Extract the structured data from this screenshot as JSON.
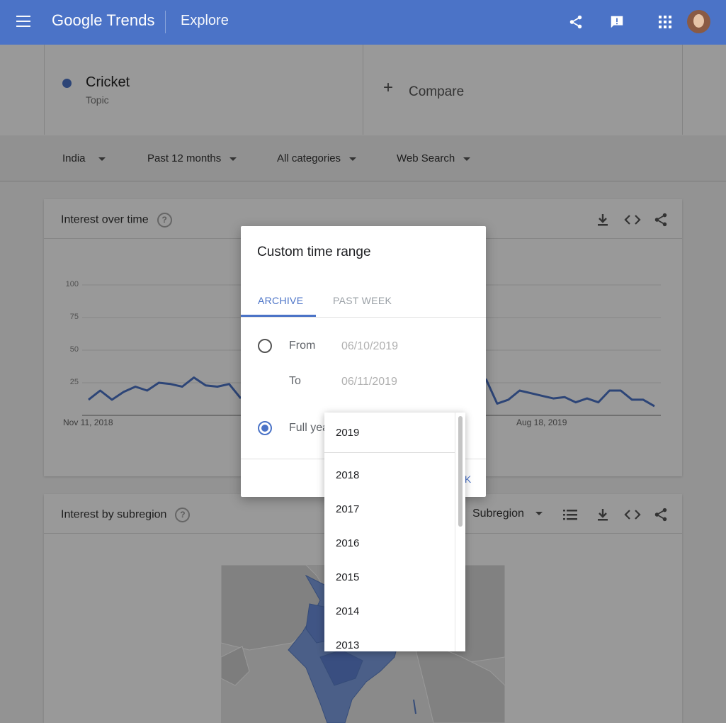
{
  "header": {
    "logo_google": "Google",
    "logo_trends": "Trends",
    "section": "Explore"
  },
  "term": {
    "name": "Cricket",
    "type": "Topic",
    "dot_color": "#4b73c7"
  },
  "compare_label": "Compare",
  "filters": {
    "region": "India",
    "time": "Past 12 months",
    "category": "All categories",
    "property": "Web Search"
  },
  "interest_over_time": {
    "title": "Interest over time",
    "help": "?"
  },
  "chart_data": {
    "type": "line",
    "title": "Interest over time",
    "ylim": [
      0,
      100
    ],
    "y_ticks": [
      "100",
      "75",
      "50",
      "25"
    ],
    "x_tick_labels": [
      "Nov 11, 2018",
      "Aug 18, 2019"
    ],
    "grid": true,
    "series": [
      {
        "color": "#4b73c7",
        "values_left": [
          12,
          19,
          12,
          18,
          22,
          19,
          25,
          24,
          22,
          29,
          23,
          22,
          24,
          13
        ],
        "values_right": [
          28,
          9,
          12,
          19,
          17,
          15,
          13,
          14,
          10,
          13,
          10,
          19,
          19,
          12,
          12,
          7
        ]
      }
    ]
  },
  "interest_by_subregion": {
    "title": "Interest by subregion",
    "help": "?",
    "dropdown": "Subregion"
  },
  "dialog": {
    "title": "Custom time range",
    "tab_archive": "ARCHIVE",
    "tab_past_week": "PAST WEEK",
    "from_label": "From",
    "from_value": "06/10/2019",
    "to_label": "To",
    "to_value": "06/11/2019",
    "full_year_label": "Full year",
    "ok_label": "OK",
    "accent": "#4b73c7"
  },
  "year_dropdown": {
    "selected": "2019",
    "options": [
      "2018",
      "2017",
      "2016",
      "2015",
      "2014",
      "2013"
    ]
  }
}
